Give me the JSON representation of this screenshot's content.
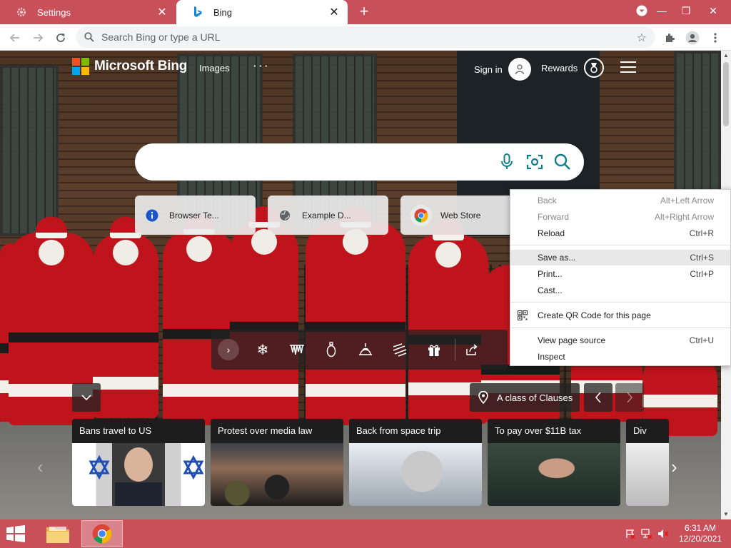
{
  "browser": {
    "tabs": [
      {
        "title": "Settings",
        "active": false
      },
      {
        "title": "Bing",
        "active": true
      }
    ],
    "new_tab_symbol": "+",
    "omnibox_placeholder": "Search Bing or type a URL"
  },
  "bing": {
    "brand": "Microsoft Bing",
    "nav_images": "Images",
    "nav_more": "· · ·",
    "sign_in": "Sign in",
    "rewards": "Rewards",
    "search_value": "",
    "quick_links": [
      {
        "label": "Browser Te...",
        "icon": "info-icon"
      },
      {
        "label": "Example D...",
        "icon": "globe-icon"
      },
      {
        "label": "Web Store",
        "icon": "chrome-icon"
      }
    ],
    "image_headline": "A class of Clauses",
    "news": [
      {
        "title": "Bans travel to US"
      },
      {
        "title": "Protest over media law"
      },
      {
        "title": "Back from space trip"
      },
      {
        "title": "To pay over $11B tax"
      },
      {
        "title": "Div"
      }
    ]
  },
  "context_menu": {
    "items": [
      {
        "label": "Back",
        "shortcut": "Alt+Left Arrow",
        "disabled": true
      },
      {
        "label": "Forward",
        "shortcut": "Alt+Right Arrow",
        "disabled": true
      },
      {
        "label": "Reload",
        "shortcut": "Ctrl+R",
        "disabled": false
      },
      {
        "label": "Save as...",
        "shortcut": "Ctrl+S",
        "disabled": false,
        "highlighted": true
      },
      {
        "label": "Print...",
        "shortcut": "Ctrl+P",
        "disabled": false
      },
      {
        "label": "Cast...",
        "shortcut": "",
        "disabled": false
      },
      {
        "label": "Create QR Code for this page",
        "shortcut": "",
        "disabled": false
      },
      {
        "label": "View page source",
        "shortcut": "Ctrl+U",
        "disabled": false
      },
      {
        "label": "Inspect",
        "shortcut": "",
        "disabled": false
      }
    ]
  },
  "taskbar": {
    "time": "6:31 AM",
    "date": "12/20/2021"
  },
  "colors": {
    "tab_strip": "#c8505a",
    "taskbar": "#c94f59",
    "bing_teal": "#0f7c8c",
    "ms_red": "#f25022",
    "ms_green": "#7fba00",
    "ms_blue": "#00a4ef",
    "ms_yellow": "#ffb900"
  }
}
